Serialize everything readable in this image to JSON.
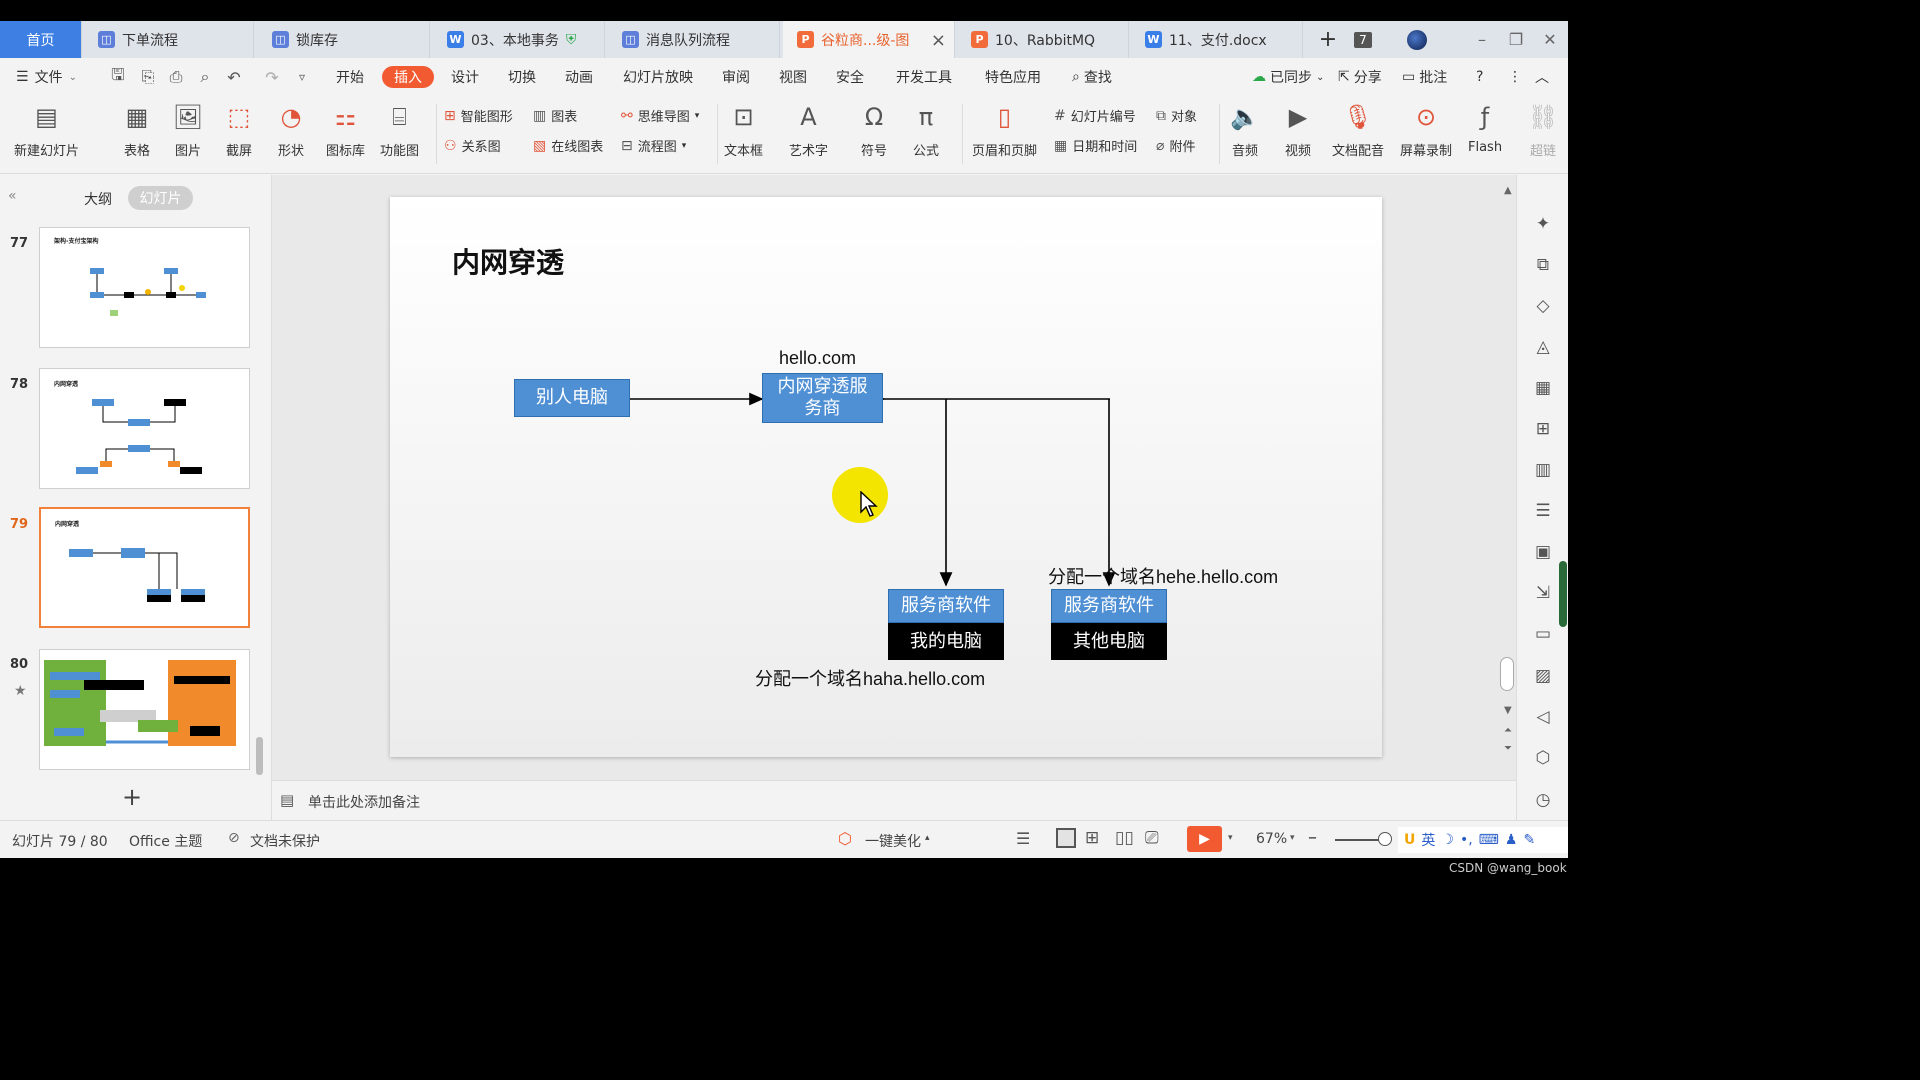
{
  "tabs": {
    "home": "首页",
    "items": [
      {
        "label": "下单流程",
        "icon": "flow-doc-icon"
      },
      {
        "label": "锁库存",
        "icon": "flow-doc-icon"
      },
      {
        "label": "03、本地事务",
        "icon": "word-doc-icon"
      },
      {
        "label": "消息队列流程",
        "icon": "flow-doc-icon"
      },
      {
        "label": "谷粒商...级-图",
        "icon": "ppt-doc-icon"
      },
      {
        "label": "10、RabbitMQ",
        "icon": "ppt-doc-icon"
      },
      {
        "label": "11、支付.docx",
        "icon": "word-doc-icon"
      }
    ],
    "count_badge": "7"
  },
  "menu": {
    "file": "文件",
    "items": [
      "开始",
      "插入",
      "设计",
      "切换",
      "动画",
      "幻灯片放映",
      "审阅",
      "视图",
      "安全",
      "开发工具",
      "特色应用"
    ],
    "active": "插入",
    "search": "查找",
    "sync": "已同步",
    "share": "分享",
    "comment": "批注"
  },
  "ribbon": {
    "new_slide": "新建幻灯片",
    "table": "表格",
    "picture": "图片",
    "screenshot": "截屏",
    "shape": "形状",
    "icon_lib": "图标库",
    "function_chart": "功能图",
    "smart_shape": "智能图形",
    "chart": "图表",
    "relation": "关系图",
    "online_chart": "在线图表",
    "mindmap": "思维导图",
    "flowchart": "流程图",
    "textbox": "文本框",
    "wordart": "艺术字",
    "symbol": "符号",
    "formula": "公式",
    "header_footer": "页眉和页脚",
    "slide_number": "幻灯片编号",
    "datetime": "日期和时间",
    "object": "对象",
    "attachment": "附件",
    "audio": "音频",
    "video": "视频",
    "doc_dub": "文档配音",
    "screen_record": "屏幕录制",
    "flash": "Flash",
    "hyperlink": "超链"
  },
  "panel": {
    "outline": "大纲",
    "slides": "幻灯片",
    "thumbs": [
      {
        "num": "77",
        "title": "架构-支付宝架构"
      },
      {
        "num": "78",
        "title": "内网穿透"
      },
      {
        "num": "79",
        "title": "内网穿透"
      },
      {
        "num": "80",
        "title": ""
      }
    ]
  },
  "slide": {
    "title": "内网穿透",
    "other_pc": "别人电脑",
    "domain_top": "hello.com",
    "provider": "内网穿透服务商",
    "svc1": "服务商软件",
    "pc1": "我的电脑",
    "svc2": "服务商软件",
    "pc2": "其他电脑",
    "label_haha": "分配一个域名haha.hello.com",
    "label_hehe": "分配一个域名hehe.hello.com"
  },
  "notes": {
    "placeholder": "单击此处添加备注"
  },
  "status": {
    "slide_counter": "幻灯片 79 / 80",
    "theme": "Office 主题",
    "protect": "文档未保护",
    "beautify": "一键美化",
    "zoom": "67%"
  },
  "ime": {
    "lang": "英"
  },
  "watermark": "CSDN @wang_book",
  "colors": {
    "accent": "#f25b32",
    "box_blue": "#4f90d4",
    "home_tab": "#3e7fe3",
    "cursor_halo": "#f3e500"
  }
}
